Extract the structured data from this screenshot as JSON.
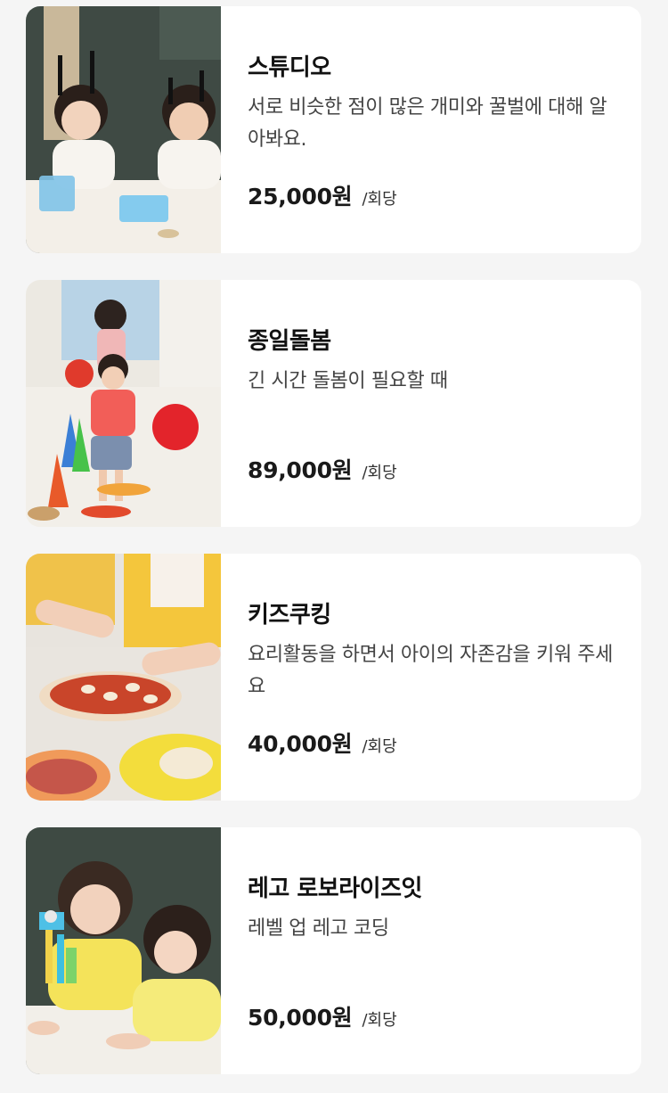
{
  "programs": [
    {
      "image": "kids-ant-science-photo",
      "title": "스튜디오",
      "description": "서로 비슷한 점이 많은 개미와 꿀벌에 대해 알아봐요.",
      "price": "25,000원",
      "unit": "/회당"
    },
    {
      "image": "toddler-balloon-play-photo",
      "title": "종일돌봄",
      "description": "긴 시간 돌봄이 필요할 때",
      "price": "89,000원",
      "unit": "/회당"
    },
    {
      "image": "kids-pizza-cooking-photo",
      "title": "키즈쿠킹",
      "description": "요리활동을 하면서 아이의 자존감을 키워 주세요",
      "price": "40,000원",
      "unit": "/회당"
    },
    {
      "image": "kids-lego-robot-photo",
      "title": "레고 로보라이즈잇",
      "description": "레벨 업 레고 코딩",
      "price": "50,000원",
      "unit": "/회당"
    }
  ]
}
